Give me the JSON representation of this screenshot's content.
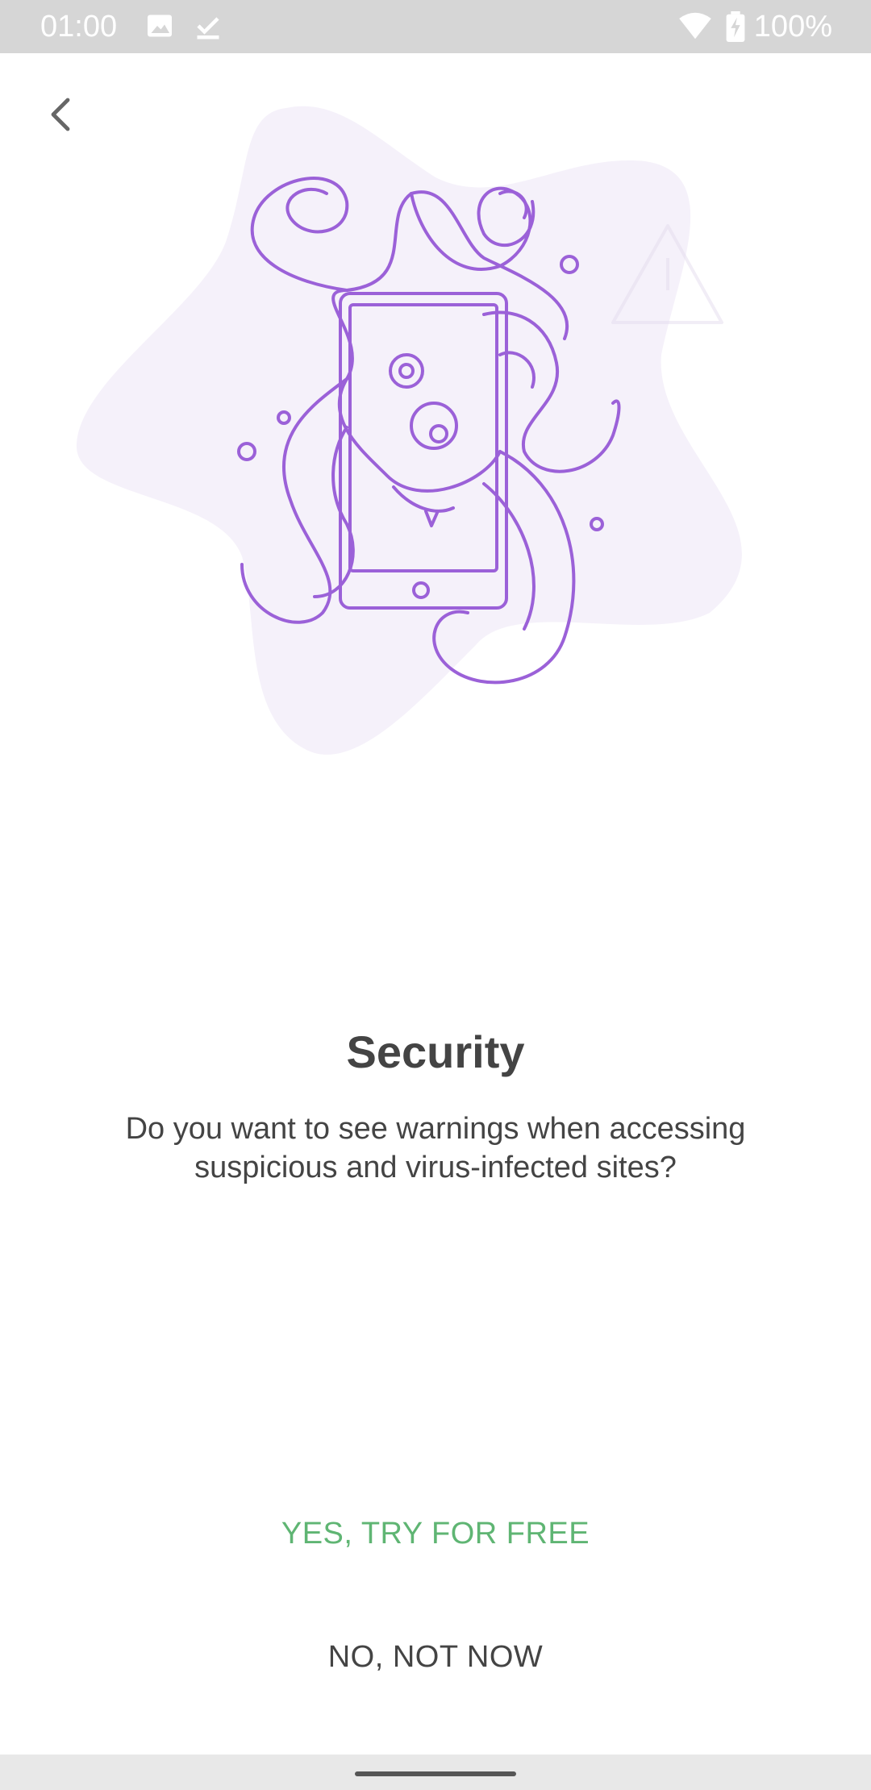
{
  "status_bar": {
    "time": "01:00",
    "battery": "100%",
    "icons": [
      "image-icon",
      "download-done-icon",
      "wifi-icon",
      "battery-charging-icon"
    ]
  },
  "header": {
    "back_icon": "chevron-left-icon"
  },
  "illustration": {
    "name": "octopus-over-phone",
    "accent_color": "#9b61d8",
    "bg_color": "#f5f1fa"
  },
  "content": {
    "title": "Security",
    "description": "Do you want to see warnings when accessing suspicious and virus-infected sites?"
  },
  "actions": {
    "primary_label": "YES, TRY FOR FREE",
    "secondary_label": "NO, NOT NOW",
    "primary_color": "#5fb573"
  }
}
